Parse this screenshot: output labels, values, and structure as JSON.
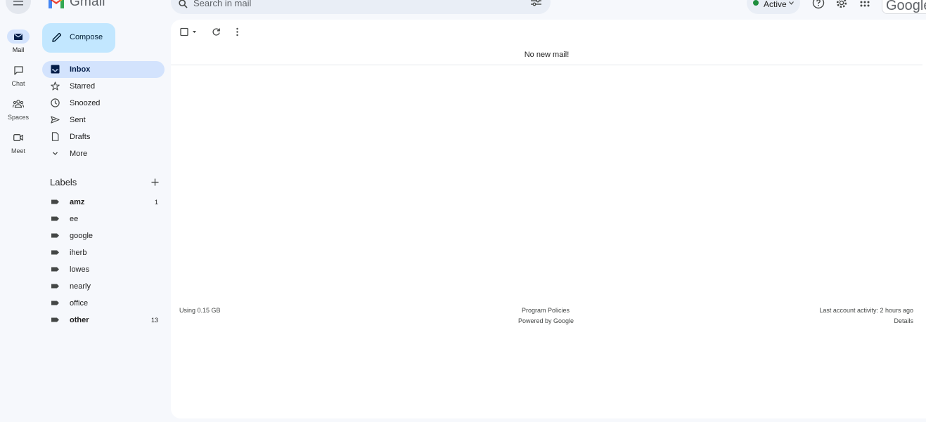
{
  "app": {
    "logo_text": "Gmail",
    "search_placeholder": "Search in mail",
    "status": "Active",
    "account_text": "Google"
  },
  "rail": {
    "items": [
      {
        "label": "Mail",
        "icon": "mail-icon",
        "active": true
      },
      {
        "label": "Chat",
        "icon": "chat-icon",
        "active": false
      },
      {
        "label": "Spaces",
        "icon": "spaces-icon",
        "active": false
      },
      {
        "label": "Meet",
        "icon": "meet-icon",
        "active": false
      }
    ]
  },
  "sidebar": {
    "compose_label": "Compose",
    "nav": [
      {
        "label": "Inbox",
        "icon": "inbox-icon",
        "active": true
      },
      {
        "label": "Starred",
        "icon": "star-icon"
      },
      {
        "label": "Snoozed",
        "icon": "clock-icon"
      },
      {
        "label": "Sent",
        "icon": "send-icon"
      },
      {
        "label": "Drafts",
        "icon": "draft-icon"
      },
      {
        "label": "More",
        "icon": "chevron-down-icon"
      }
    ],
    "labels_heading": "Labels",
    "labels": [
      {
        "label": "amz",
        "count": "1",
        "bold": true
      },
      {
        "label": "ee",
        "count": ""
      },
      {
        "label": "google",
        "count": ""
      },
      {
        "label": "iherb",
        "count": ""
      },
      {
        "label": "lowes",
        "count": ""
      },
      {
        "label": "nearly",
        "count": ""
      },
      {
        "label": "office",
        "count": ""
      },
      {
        "label": "other",
        "count": "13",
        "bold": true
      }
    ]
  },
  "main": {
    "empty_message": "No new mail!",
    "storage": "Using 0.15 GB",
    "program_policies": "Program Policies",
    "powered_by": "Powered by Google",
    "last_activity": "Last account activity: 2 hours ago",
    "details": "Details"
  },
  "colors": {
    "background": "#f6f8fc",
    "active_nav": "#d3e3fd",
    "compose": "#c2e7ff",
    "status_dot": "#1e8e3e"
  }
}
